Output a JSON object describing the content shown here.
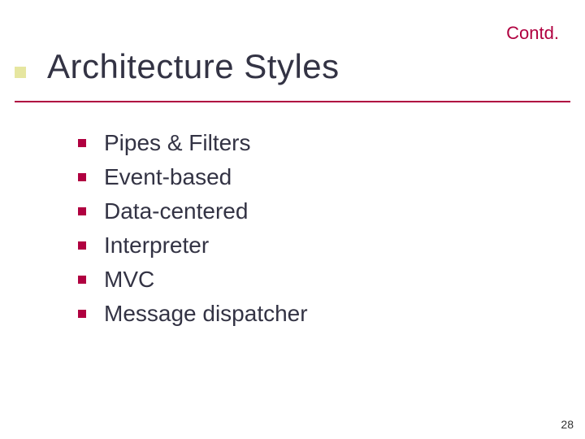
{
  "header_label": "Contd.",
  "title": "Architecture Styles",
  "items": [
    "Pipes & Filters",
    "Event-based",
    "Data-centered",
    "Interpreter",
    "MVC",
    "Message dispatcher"
  ],
  "page_number": "28"
}
